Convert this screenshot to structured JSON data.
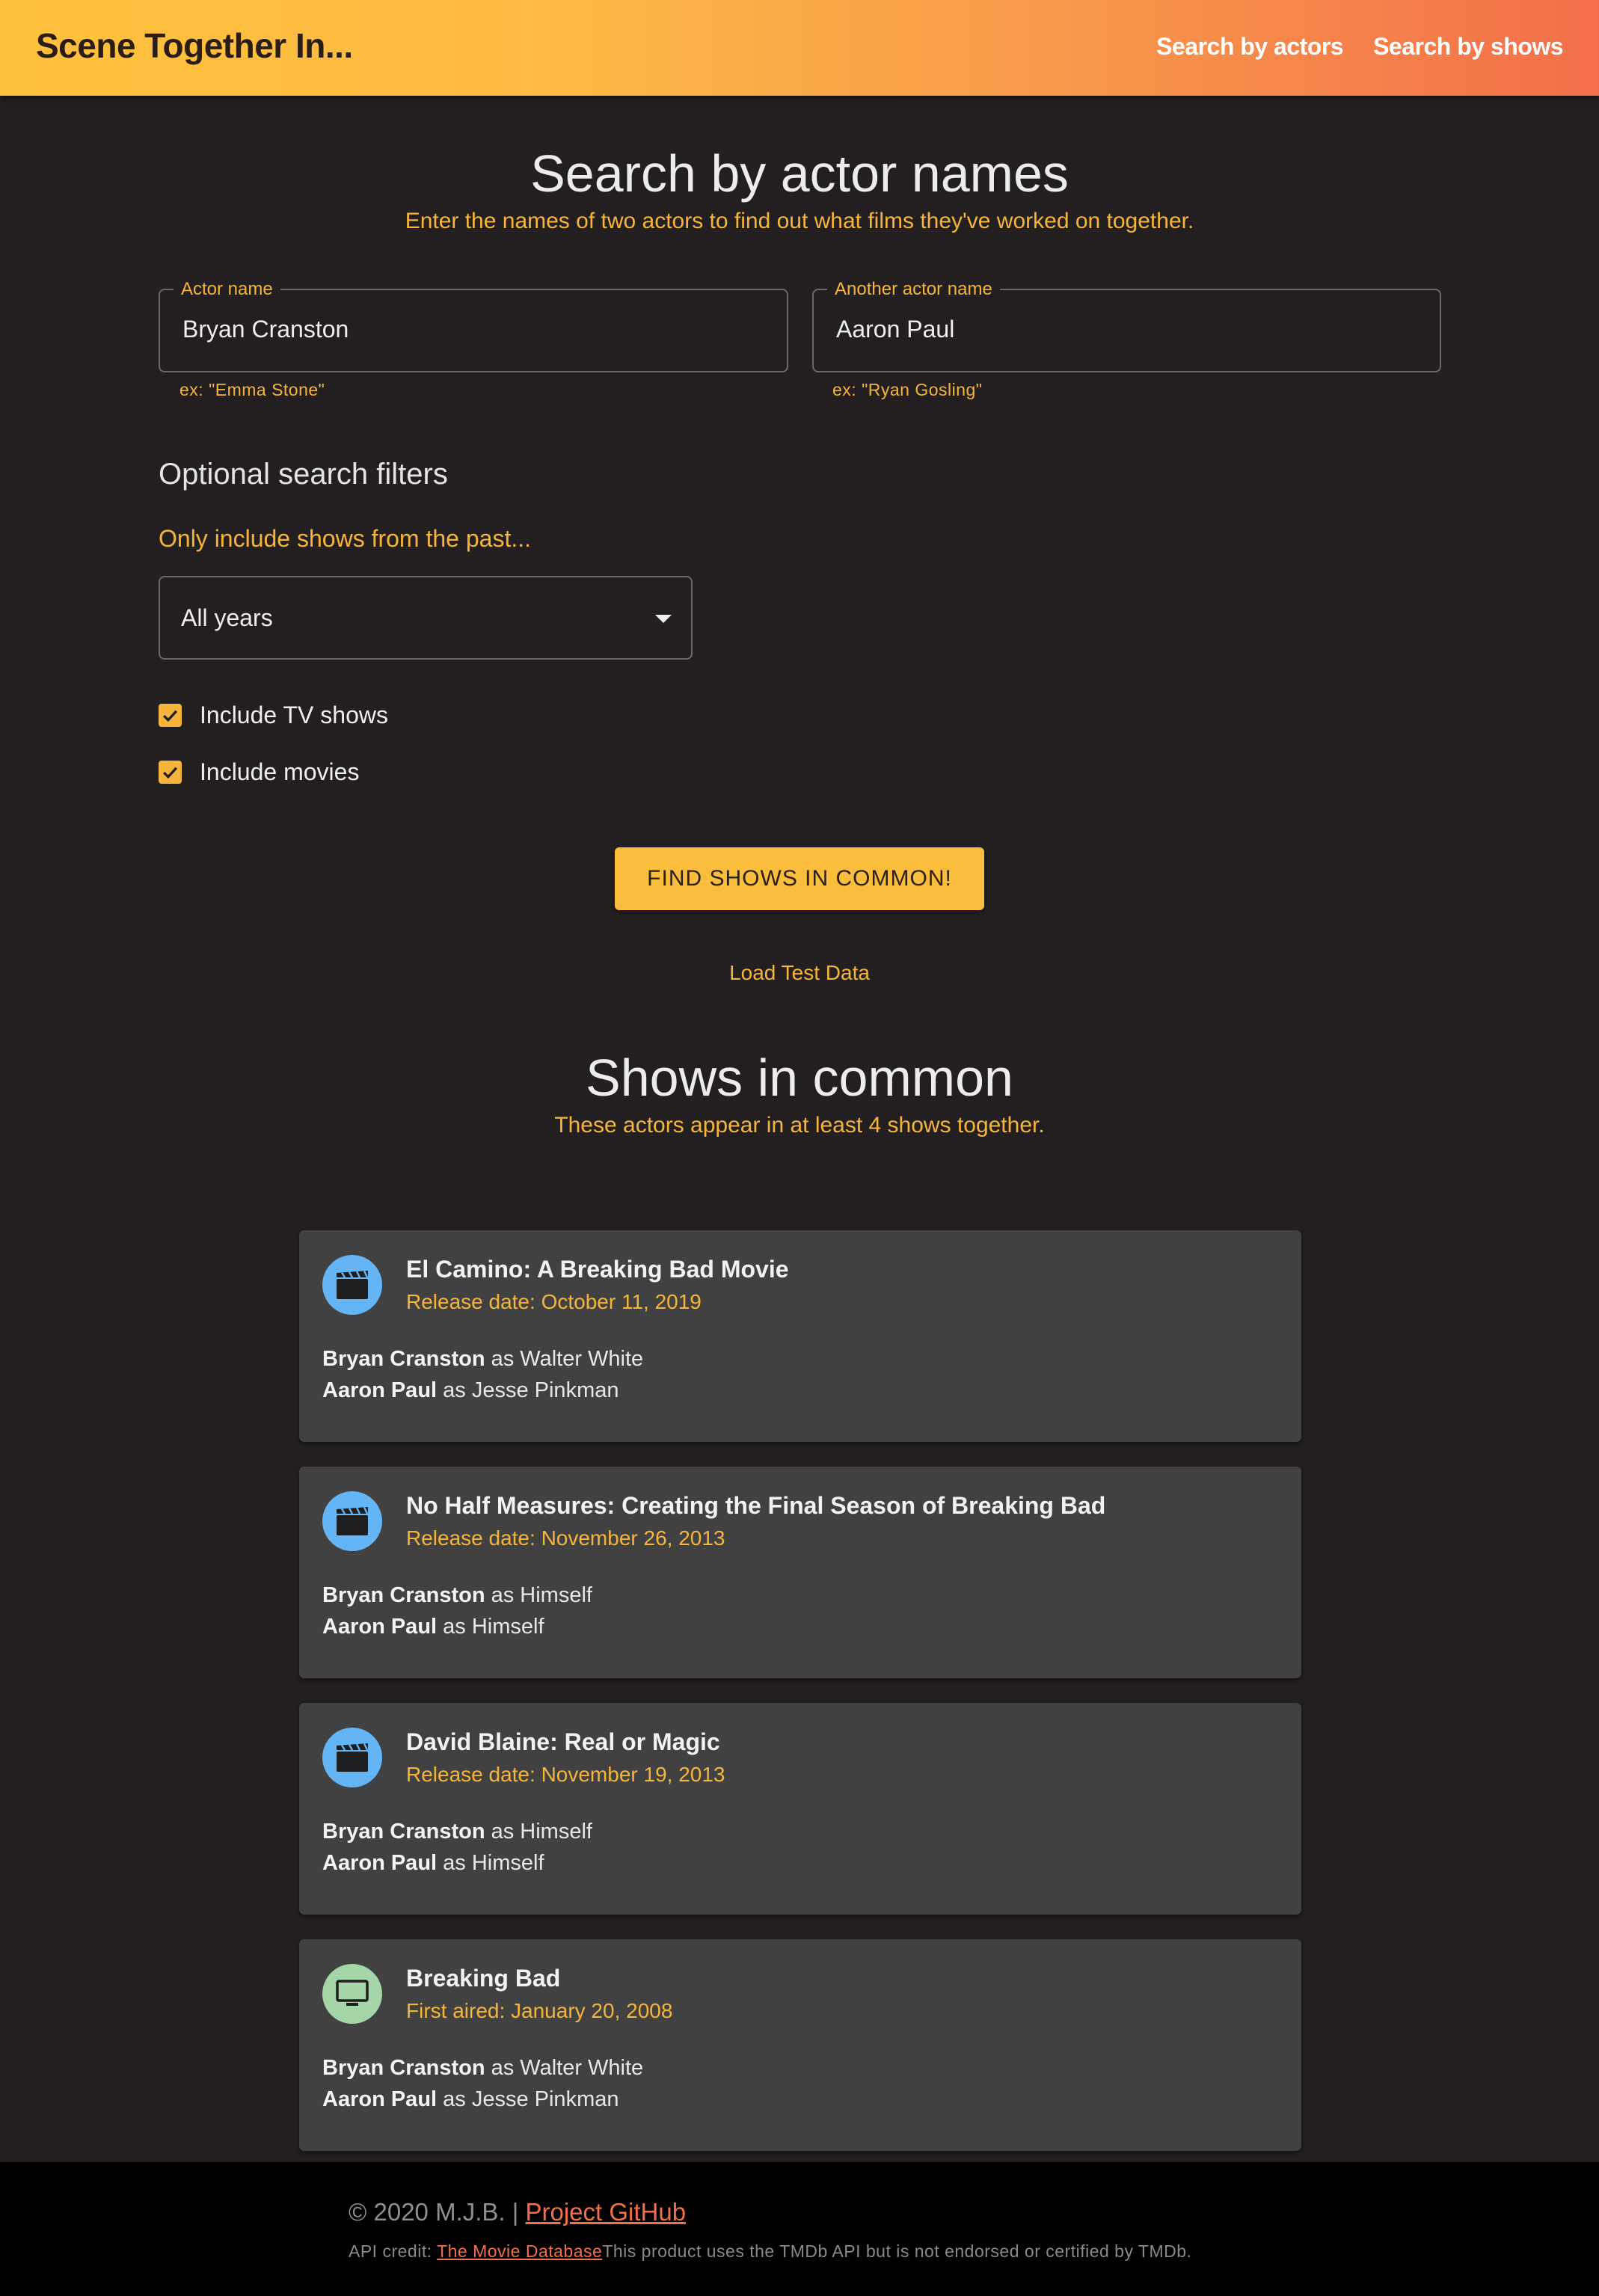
{
  "app": {
    "title": "Scene Together In...",
    "nav": [
      "Search by actors",
      "Search by shows"
    ]
  },
  "search": {
    "heading": "Search by actor names",
    "subheading": "Enter the names of two actors to find out what films they've worked on together.",
    "actor1": {
      "label": "Actor name",
      "value": "Bryan Cranston",
      "helper": "ex: \"Emma Stone\""
    },
    "actor2": {
      "label": "Another actor name",
      "value": "Aaron Paul",
      "helper": "ex: \"Ryan Gosling\""
    }
  },
  "filters": {
    "heading": "Optional search filters",
    "years_label": "Only include shows from the past...",
    "years_value": "All years",
    "include_tv": {
      "label": "Include TV shows",
      "checked": true
    },
    "include_movies": {
      "label": "Include movies",
      "checked": true
    }
  },
  "actions": {
    "find_label": "FIND SHOWS IN COMMON!",
    "test_data_label": "Load Test Data"
  },
  "results": {
    "heading": "Shows in common",
    "subheading": "These actors appear in at least 4 shows together.",
    "items": [
      {
        "title": "El Camino: A Breaking Bad Movie",
        "date": "Release date: October 11, 2019",
        "icon": "movie-clapper-icon",
        "icon_color": "#64b5f6",
        "roles": [
          {
            "actor": "Bryan Cranston",
            "as": " as Walter White"
          },
          {
            "actor": "Aaron Paul",
            "as": " as Jesse Pinkman"
          }
        ]
      },
      {
        "title": "No Half Measures: Creating the Final Season of Breaking Bad",
        "date": "Release date: November 26, 2013",
        "icon": "movie-clapper-icon",
        "icon_color": "#64b5f6",
        "roles": [
          {
            "actor": "Bryan Cranston",
            "as": " as Himself"
          },
          {
            "actor": "Aaron Paul",
            "as": " as Himself"
          }
        ]
      },
      {
        "title": "David Blaine: Real or Magic",
        "date": "Release date: November 19, 2013",
        "icon": "movie-clapper-icon",
        "icon_color": "#64b5f6",
        "roles": [
          {
            "actor": "Bryan Cranston",
            "as": " as Himself"
          },
          {
            "actor": "Aaron Paul",
            "as": " as Himself"
          }
        ]
      },
      {
        "title": "Breaking Bad",
        "date": "First aired: January 20, 2008",
        "icon": "tv-icon",
        "icon_color": "#a5d6a7",
        "roles": [
          {
            "actor": "Bryan Cranston",
            "as": " as Walter White"
          },
          {
            "actor": "Aaron Paul",
            "as": " as Jesse Pinkman"
          }
        ]
      }
    ]
  },
  "footer": {
    "copyright": "© 2020 M.J.B. | ",
    "github_label": "Project GitHub",
    "api_prefix": "API credit: ",
    "api_link": "The Movie Database",
    "api_disclaimer": "This product uses the TMDb API but is not endorsed or certified by TMDb."
  }
}
